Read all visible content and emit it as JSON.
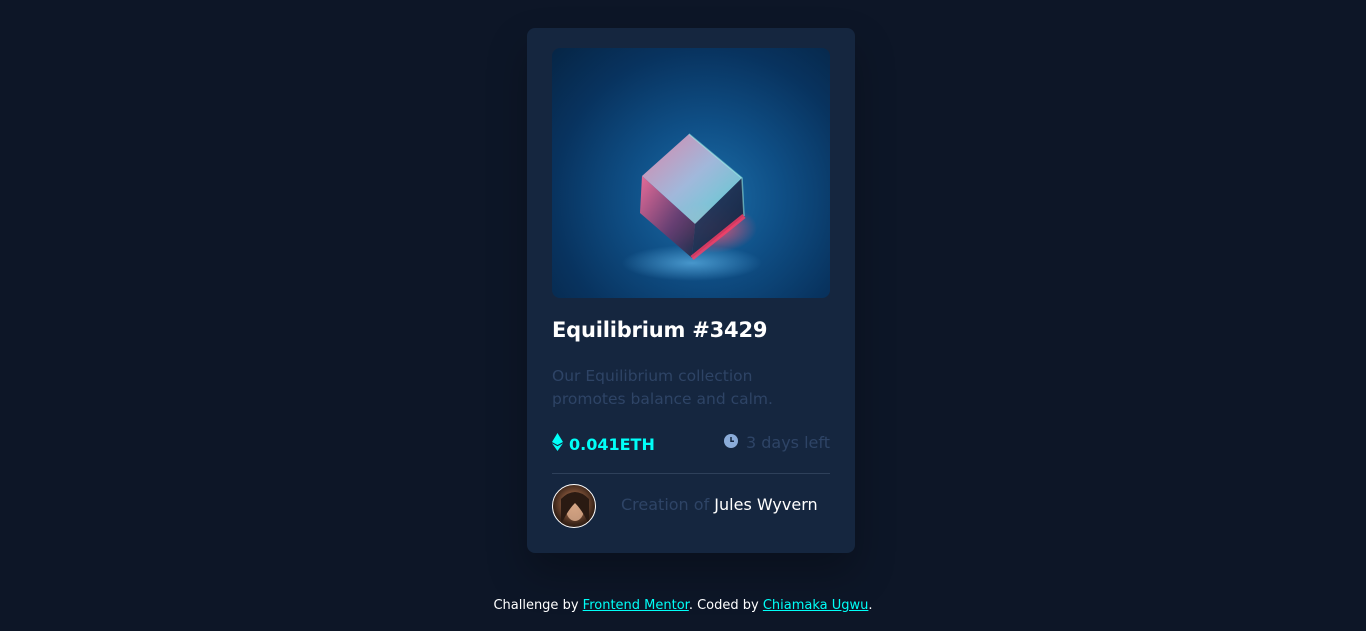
{
  "card": {
    "image_alt": "equilibrium-cube-image",
    "title": "Equilibrium #3429",
    "description": "Our Equilibrium collection promotes balance and calm.",
    "price": "0.041ETH",
    "price_icon": "ethereum-icon",
    "time_left": "3 days left",
    "time_icon": "clock-icon",
    "creator_prefix": "Creation of",
    "creator_name": "Jules Wyvern"
  },
  "footer": {
    "prefix": "Challenge by ",
    "challenge_link": "Frontend Mentor",
    "middle": ". Coded by ",
    "author_link": "Chiamaka Ugwu",
    "suffix": "."
  },
  "colors": {
    "background": "#0d1627",
    "card": "#15263f",
    "accent_cyan": "#00fff8",
    "muted_text": "#2e4466",
    "white": "#ffffff"
  }
}
